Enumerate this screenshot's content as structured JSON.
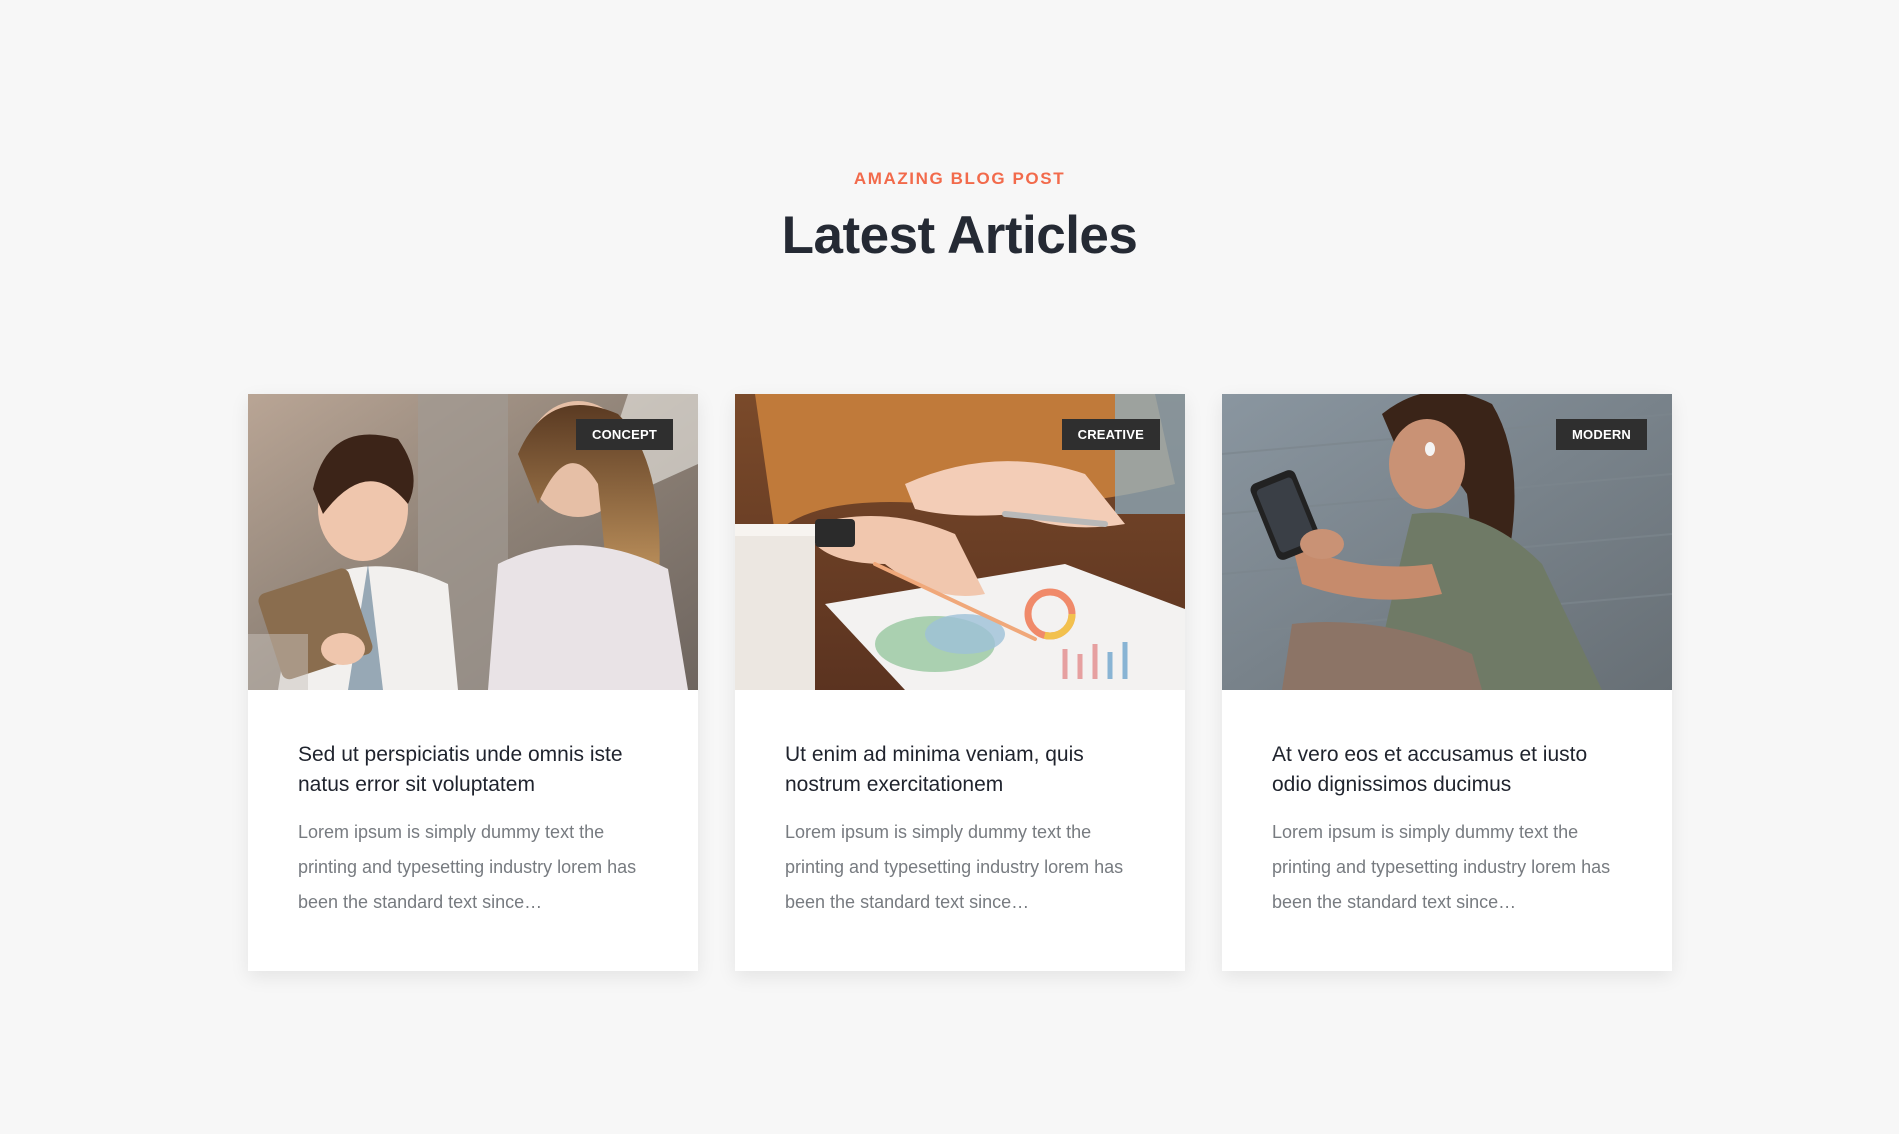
{
  "section": {
    "eyebrow": "AMAZING BLOG POST",
    "heading": "Latest Articles"
  },
  "colors": {
    "accent": "#f26a4b",
    "heading": "#252a34",
    "badge_bg": "#2f2f2f",
    "page_bg": "#f7f7f7"
  },
  "articles": [
    {
      "category": "CONCEPT",
      "title": "Sed ut perspiciatis unde omnis iste natus error sit voluptatem",
      "excerpt": "Lorem ipsum is simply dummy text the printing and typesetting industry lorem has been the standard text since…",
      "image": "two-women-with-tablet-photo"
    },
    {
      "category": "CREATIVE",
      "title": "Ut enim ad minima veniam, quis nostrum exercitationem",
      "excerpt": "Lorem ipsum is simply dummy text the printing and typesetting industry lorem has been the standard text since…",
      "image": "hands-over-chart-report-photo"
    },
    {
      "category": "MODERN",
      "title": "At vero eos et accusamus et iusto odio dignissimos ducimus",
      "excerpt": "Lorem ipsum is simply dummy text the printing and typesetting industry lorem has been the standard text since…",
      "image": "woman-with-phone-on-steps-photo"
    }
  ]
}
